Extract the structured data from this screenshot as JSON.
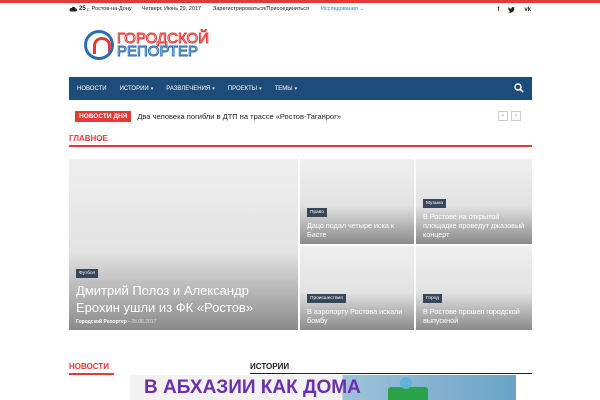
{
  "topbar": {
    "weather_temp": "25",
    "weather_unit": "C",
    "city": "Ростов-на-Дону",
    "date": "Четверг, Июнь 29, 2017",
    "register": "Зарегистрироваться/Присоединиться",
    "research": "Исследования",
    "social": [
      "f",
      "t",
      "vk"
    ]
  },
  "logo": {
    "line1": "ГОРОДСКОЙ",
    "line2": "РЕПОРТЕР"
  },
  "nav": {
    "items": [
      {
        "label": "НОВОСТИ",
        "has_dropdown": false
      },
      {
        "label": "ИСТОРИИ",
        "has_dropdown": true
      },
      {
        "label": "РАЗВЛЕЧЕНИЯ",
        "has_dropdown": true
      },
      {
        "label": "ПРОЕКТЫ",
        "has_dropdown": true
      },
      {
        "label": "ТЕМЫ",
        "has_dropdown": true
      }
    ],
    "search_icon": "search-icon"
  },
  "ticker": {
    "label": "НОВОСТИ ДНЯ",
    "headline": "Два человека погибли в ДТП на трассе «Ростов-Таганрог»"
  },
  "main_section": {
    "title": "ГЛАВНОЕ",
    "big": {
      "category": "Футбол",
      "title": "Дмитрий Полоз и Александр Ерохин ушли из ФК «Ростов»",
      "author": "Городской Репортер",
      "date": "28.06.2017"
    },
    "small": [
      {
        "category": "Право",
        "title": "Дацо подал четыре иска к Басте"
      },
      {
        "category": "Музыка",
        "title": "В Ростове на открытой площадке проведут джазовый концерт"
      },
      {
        "category": "Происшествия",
        "title": "В аэропорту Ростова искали бомбу"
      },
      {
        "category": "Город",
        "title": "В Ростове прошел городской выпускной"
      }
    ]
  },
  "bottom": {
    "news_title": "НОВОСТИ",
    "stories_title": "ИСТОРИИ",
    "banner_text": "В АБХАЗИИ КАК ДОМА"
  },
  "colors": {
    "accent": "#e53935",
    "nav": "#1e4c7a",
    "category": "#37475a"
  }
}
